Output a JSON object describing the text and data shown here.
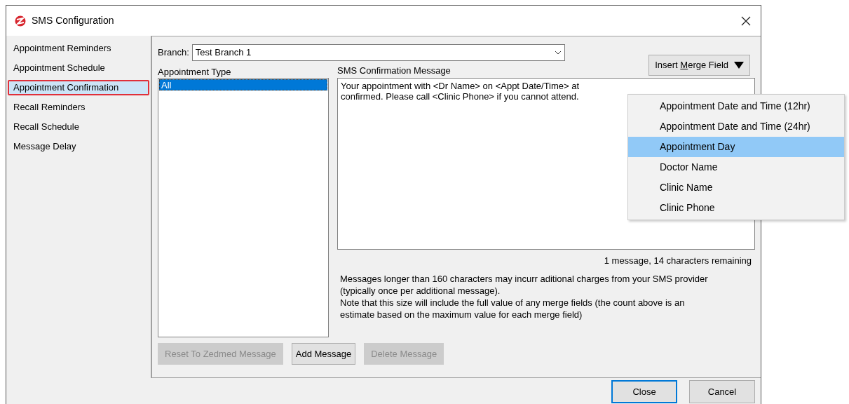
{
  "window": {
    "title": "SMS Configuration"
  },
  "sidebar": {
    "items": [
      {
        "label": "Appointment Reminders",
        "selected": false
      },
      {
        "label": "Appointment Schedule",
        "selected": false
      },
      {
        "label": "Appointment Confirmation",
        "selected": true
      },
      {
        "label": "Recall Reminders",
        "selected": false
      },
      {
        "label": "Recall Schedule",
        "selected": false
      },
      {
        "label": "Message Delay",
        "selected": false
      }
    ]
  },
  "branch": {
    "label": "Branch:",
    "value": "Test Branch 1"
  },
  "appointment_type": {
    "label": "Appointment Type",
    "items": [
      {
        "label": "All",
        "selected": true
      }
    ]
  },
  "message": {
    "label": "SMS Confirmation Message",
    "lines": [
      "Your appointment with <Dr Name> on <Appt Date/Time> at",
      "confirmed. Please call <Clinic Phone> if you cannot attend."
    ],
    "counter": "1 message, 14 characters remaining"
  },
  "merge_button": {
    "before": "Insert ",
    "access_key": "M",
    "after": "erge Field"
  },
  "merge_menu": [
    {
      "label": "Appointment Date and Time (12hr)",
      "selected": false
    },
    {
      "label": "Appointment Date and Time (24hr)",
      "selected": false
    },
    {
      "label": "Appointment Day",
      "selected": true
    },
    {
      "label": "Doctor Name",
      "selected": false
    },
    {
      "label": "Clinic Name",
      "selected": false
    },
    {
      "label": "Clinic Phone",
      "selected": false
    }
  ],
  "notes": [
    "Messages longer than 160 characters may incurr aditional charges from your SMS provider (typically once per additional message).",
    "Note that this size will include the full value of any merge fields (the count above is an estimate based on the maximum value for each merge field)"
  ],
  "buttons": [
    {
      "label": "Reset To Zedmed Message",
      "disabled": true
    },
    {
      "label": "Add Message",
      "disabled": false
    },
    {
      "label": "Delete Message",
      "disabled": true
    }
  ],
  "footer_buttons": [
    {
      "label": "Close",
      "default": true
    },
    {
      "label": "Cancel",
      "default": false
    }
  ]
}
